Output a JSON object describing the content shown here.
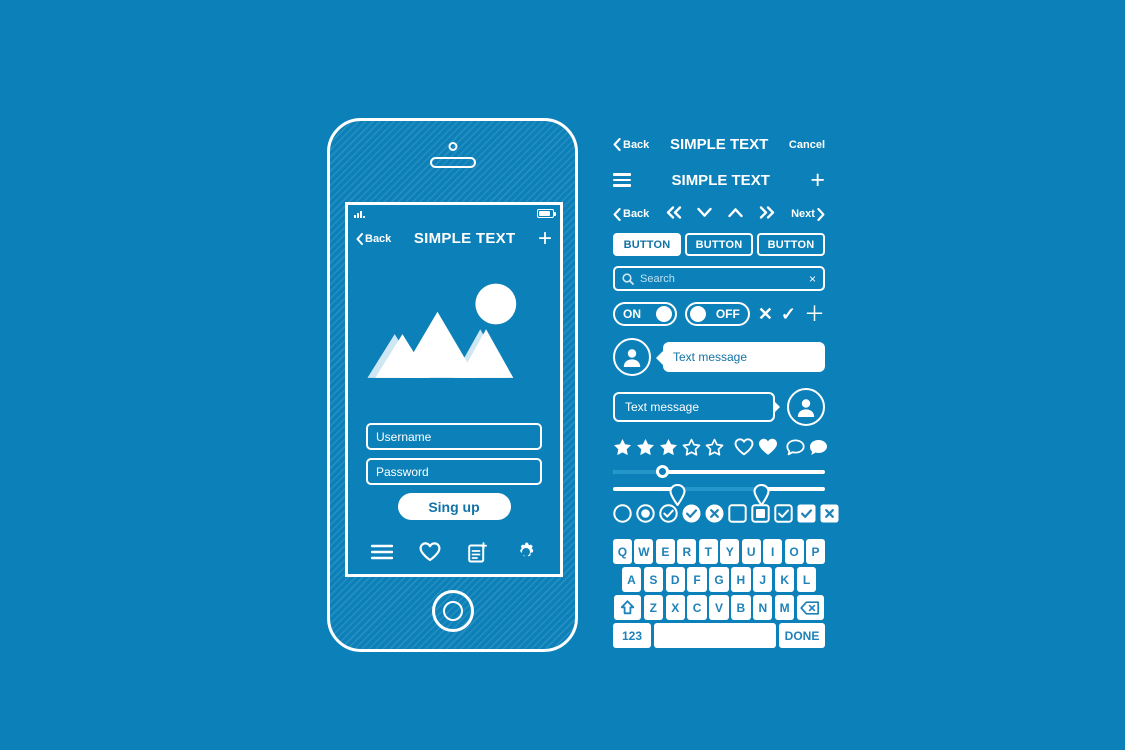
{
  "theme": {
    "background": "#0c80b8",
    "ink": "#ffffff",
    "accent_text": "#1273a8",
    "placeholder": "#bfe2f2"
  },
  "phone": {
    "status_bar": {
      "signal_icon": "signal-bars-icon",
      "battery_icon": "battery-icon"
    },
    "navbar": {
      "back_label": "Back",
      "title": "SIMPLE TEXT",
      "add_label": "+"
    },
    "hero": {
      "icon": "mountains-and-sun-illustration"
    },
    "form": {
      "username_placeholder": "Username",
      "password_placeholder": "Password",
      "submit_label": "Sing up"
    },
    "tabbar": {
      "items": [
        {
          "name": "menu-icon",
          "label": "Menu"
        },
        {
          "name": "heart-icon",
          "label": "Favorites"
        },
        {
          "name": "new-document-icon",
          "label": "New note"
        },
        {
          "name": "gear-icon",
          "label": "Settings"
        }
      ]
    }
  },
  "kit": {
    "bar_a": {
      "back_label": "Back",
      "title": "SIMPLE TEXT",
      "cancel_label": "Cancel"
    },
    "bar_b": {
      "menu_icon": "hamburger-icon",
      "title": "SIMPLE TEXT",
      "add_label": "+"
    },
    "bar_c": {
      "back_label": "Back",
      "first_label": "«",
      "down_label": "⌄",
      "up_label": "⌃",
      "last_label": "»",
      "next_label": "Next",
      "next_chevron": "›",
      "back_chevron": "‹"
    },
    "buttons": [
      {
        "label": "BUTTON",
        "state": "active"
      },
      {
        "label": "BUTTON",
        "state": "default"
      },
      {
        "label": "BUTTON",
        "state": "default"
      }
    ],
    "search": {
      "placeholder": "Search",
      "value": "",
      "clear_label": "×",
      "icon": "search-icon"
    },
    "toggles": [
      {
        "label": "ON",
        "state": "on"
      },
      {
        "label": "OFF",
        "state": "off"
      }
    ],
    "inline_icons": [
      {
        "name": "close-x-icon",
        "glyph": "✕"
      },
      {
        "name": "check-icon",
        "glyph": "✓"
      },
      {
        "name": "plus-icon",
        "glyph": "＋"
      }
    ],
    "messages": [
      {
        "avatar": "user-avatar-icon",
        "text": "Text message",
        "side": "incoming"
      },
      {
        "avatar": "user-avatar-icon",
        "text": "Text message",
        "side": "outgoing"
      }
    ],
    "ratings": {
      "stars_filled": 3,
      "stars_total": 5,
      "extras": [
        {
          "name": "heart-outline-icon"
        },
        {
          "name": "heart-filled-icon"
        },
        {
          "name": "chat-outline-icon"
        },
        {
          "name": "chat-filled-icon"
        }
      ]
    },
    "sliders": [
      {
        "name": "single-slider",
        "value": 23
      },
      {
        "name": "range-slider",
        "values": [
          30,
          70
        ]
      }
    ],
    "selection_controls": [
      {
        "name": "radio-empty",
        "shape": "circle",
        "fill": "none",
        "mark": "none"
      },
      {
        "name": "radio-selected",
        "shape": "circle",
        "fill": "dot",
        "mark": "none"
      },
      {
        "name": "circle-check-outline",
        "shape": "circle",
        "fill": "none",
        "mark": "check"
      },
      {
        "name": "circle-check-filled",
        "shape": "circle",
        "fill": "solid",
        "mark": "check"
      },
      {
        "name": "circle-cross-filled",
        "shape": "circle",
        "fill": "solid",
        "mark": "cross"
      },
      {
        "name": "checkbox-empty",
        "shape": "square",
        "fill": "none",
        "mark": "none"
      },
      {
        "name": "checkbox-filled-box",
        "shape": "square",
        "fill": "box",
        "mark": "none"
      },
      {
        "name": "checkbox-check-outline",
        "shape": "square",
        "fill": "none",
        "mark": "check"
      },
      {
        "name": "checkbox-check-filled",
        "shape": "square",
        "fill": "solid",
        "mark": "check"
      },
      {
        "name": "checkbox-cross-filled",
        "shape": "square",
        "fill": "solid",
        "mark": "cross"
      }
    ],
    "keyboard": {
      "row1": [
        "Q",
        "W",
        "E",
        "R",
        "T",
        "Y",
        "U",
        "I",
        "O",
        "P"
      ],
      "row2": [
        "A",
        "S",
        "D",
        "F",
        "G",
        "H",
        "J",
        "K",
        "L"
      ],
      "row3": [
        "Z",
        "X",
        "C",
        "V",
        "B",
        "N",
        "M"
      ],
      "shift_label": "shift-icon",
      "backspace_label": "backspace-icon",
      "numbers_label": "123",
      "space_label": "",
      "done_label": "DONE"
    }
  }
}
